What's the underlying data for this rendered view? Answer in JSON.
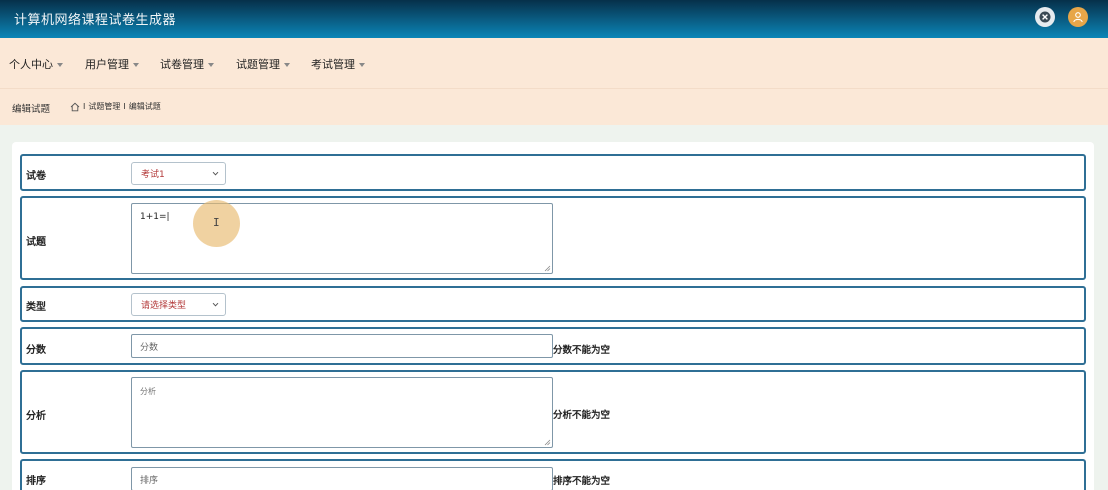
{
  "header": {
    "app_title": "计算机网络课程试卷生成器",
    "icons": [
      "close-icon",
      "user-icon"
    ],
    "accent_color": "#0a6f9e"
  },
  "nav": {
    "items": [
      {
        "label": "个人中心"
      },
      {
        "label": "用户管理"
      },
      {
        "label": "试卷管理"
      },
      {
        "label": "试题管理"
      },
      {
        "label": "考试管理"
      }
    ]
  },
  "breadcrumb": {
    "page_title": "编辑试题",
    "separator": "I",
    "items": [
      "试题管理",
      "编辑试题"
    ]
  },
  "form": {
    "paper": {
      "label": "试卷",
      "selected": "考试1"
    },
    "question": {
      "label": "试题",
      "value": "1+1=|"
    },
    "type": {
      "label": "类型",
      "selected": "请选择类型"
    },
    "score": {
      "label": "分数",
      "placeholder": "分数",
      "error": "分数不能为空"
    },
    "analysis": {
      "label": "分析",
      "placeholder": "分析",
      "error": "分析不能为空"
    },
    "order": {
      "label": "排序",
      "placeholder": "排序",
      "error": "排序不能为空"
    }
  },
  "colors": {
    "topbar": "#0a6f9e",
    "navbar": "#fbe8d7",
    "row_border": "#2f6f95",
    "select_text": "#b33a3a"
  }
}
